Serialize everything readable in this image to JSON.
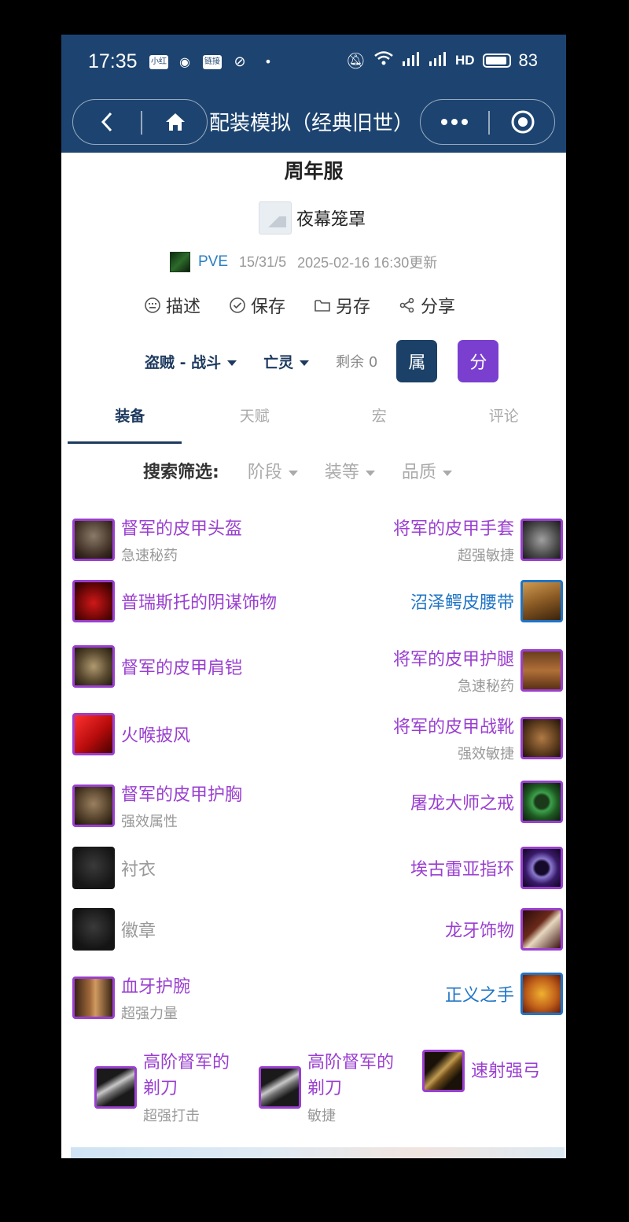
{
  "status_bar": {
    "time": "17:35",
    "icons": [
      "小红书",
      "weibo-icon",
      "链接",
      "block-icon",
      "•"
    ],
    "right": "4G 4G HD 83",
    "battery": "83"
  },
  "header": {
    "title": "配装模拟（经典旧世）",
    "back_icon": "chevron-left-icon",
    "home_icon": "home-icon",
    "more_icon": "more-dots-icon",
    "target_icon": "target-icon"
  },
  "build": {
    "name": "周年服",
    "race": "夜幕笼罩",
    "mode": "PVE",
    "talents": "15/31/5",
    "updated": "2025-02-16 16:30更新"
  },
  "actions": [
    {
      "label": "描述",
      "icon": "keyboard-icon"
    },
    {
      "label": "保存",
      "icon": "check-circle-icon"
    },
    {
      "label": "另存",
      "icon": "folder-icon"
    },
    {
      "label": "分享",
      "icon": "share-icon"
    }
  ],
  "class_row": {
    "spec": "盗贼 - 战斗",
    "race": "亡灵",
    "remaining": "剩余 0",
    "attr_btn": "属",
    "score_btn": "分"
  },
  "tabs": [
    "装备",
    "天赋",
    "宏",
    "评论"
  ],
  "filter": {
    "label": "搜索筛选:",
    "options": [
      "阶段",
      "装等",
      "品质"
    ]
  },
  "gear_left": [
    {
      "name": "督军的皮甲头盔",
      "sub": "急速秘药",
      "quality": "epic"
    },
    {
      "name": "普瑞斯托的阴谋饰物",
      "sub": "",
      "quality": "epic"
    },
    {
      "name": "督军的皮甲肩铠",
      "sub": "",
      "quality": "epic"
    },
    {
      "name": "火喉披风",
      "sub": "",
      "quality": "epic"
    },
    {
      "name": "督军的皮甲护胸",
      "sub": "强效属性",
      "quality": "epic"
    },
    {
      "name": "衬衣",
      "sub": "",
      "quality": "empty"
    },
    {
      "name": "徽章",
      "sub": "",
      "quality": "empty"
    },
    {
      "name": "血牙护腕",
      "sub": "超强力量",
      "quality": "epic"
    }
  ],
  "gear_right": [
    {
      "name": "将军的皮甲手套",
      "sub": "超强敏捷",
      "quality": "epic"
    },
    {
      "name": "沼泽鳄皮腰带",
      "sub": "",
      "quality": "rare"
    },
    {
      "name": "将军的皮甲护腿",
      "sub": "急速秘药",
      "quality": "epic"
    },
    {
      "name": "将军的皮甲战靴",
      "sub": "强效敏捷",
      "quality": "epic"
    },
    {
      "name": "屠龙大师之戒",
      "sub": "",
      "quality": "epic"
    },
    {
      "name": "埃古雷亚指环",
      "sub": "",
      "quality": "epic"
    },
    {
      "name": "龙牙饰物",
      "sub": "",
      "quality": "epic"
    },
    {
      "name": "正义之手",
      "sub": "",
      "quality": "rare"
    }
  ],
  "weapons": [
    {
      "name": "高阶督军的剃刀",
      "sub": "超强打击"
    },
    {
      "name": "高阶督军的剃刀",
      "sub": "敏捷"
    },
    {
      "name": "速射强弓",
      "sub": ""
    }
  ],
  "colors": {
    "header_bg": "#1d4470",
    "epic": "#9a3fd0",
    "rare": "#1f74c6",
    "attr_btn": "#1c4168",
    "score_btn": "#7b3fd0"
  }
}
